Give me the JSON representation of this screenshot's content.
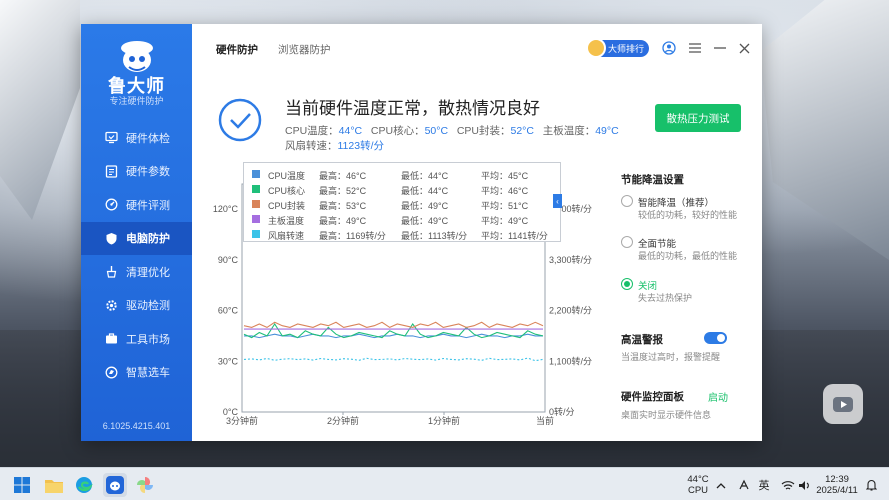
{
  "app": {
    "brand_name": "鲁大师",
    "brand_sub": "专注硬件防护",
    "version": "6.1025.4215.401",
    "nav": [
      {
        "label": "硬件体检",
        "icon": "monitor-check-icon"
      },
      {
        "label": "硬件参数",
        "icon": "list-icon"
      },
      {
        "label": "硬件评测",
        "icon": "speedometer-icon"
      },
      {
        "label": "电脑防护",
        "icon": "shield-icon",
        "active": true
      },
      {
        "label": "清理优化",
        "icon": "broom-icon"
      },
      {
        "label": "驱动检测",
        "icon": "gear-icon"
      },
      {
        "label": "工具市场",
        "icon": "briefcase-icon"
      },
      {
        "label": "智慧选车",
        "icon": "car-icon"
      }
    ],
    "tabs": [
      {
        "label": "硬件防护",
        "active": true
      },
      {
        "label": "浏览器防护",
        "active": false
      }
    ],
    "rank_button": "大师排行",
    "status": {
      "title": "当前硬件温度正常，散热情况良好",
      "line1": [
        {
          "label": "CPU温度：",
          "value": "44°C"
        },
        {
          "label": "CPU核心：",
          "value": "50°C"
        },
        {
          "label": "CPU封装：",
          "value": "52°C"
        },
        {
          "label": "主板温度：",
          "value": "49°C"
        }
      ],
      "line2": [
        {
          "label": "风扇转速：",
          "value": "1123转/分"
        }
      ]
    },
    "stress_button": "散热压力测试",
    "legend": [
      {
        "name": "CPU温度",
        "max": "最高：46°C",
        "min": "最低：44°C",
        "avg": "平均：45°C",
        "color": "#4a90d9"
      },
      {
        "name": "CPU核心",
        "max": "最高：52°C",
        "min": "最低：44°C",
        "avg": "平均：46°C",
        "color": "#1fbf7a"
      },
      {
        "name": "CPU封装",
        "max": "最高：53°C",
        "min": "最低：49°C",
        "avg": "平均：51°C",
        "color": "#d9845a"
      },
      {
        "name": "主板温度",
        "max": "最高：49°C",
        "min": "最低：49°C",
        "avg": "平均：49°C",
        "color": "#a56ee0"
      },
      {
        "name": "风扇转速",
        "max": "最高：1169转/分",
        "min": "最低：1113转/分",
        "avg": "平均：1141转/分",
        "color": "#3cc3e8"
      }
    ],
    "right_panel": {
      "title": "节能降温设置",
      "options": [
        {
          "label": "智能降温（推荐）",
          "desc": "较低的功耗，较好的性能",
          "checked": false
        },
        {
          "label": "全面节能",
          "desc": "最低的功耗，最低的性能",
          "checked": false
        },
        {
          "label": "关闭",
          "desc": "失去过热保护",
          "checked": true
        }
      ],
      "alarm_title": "高温警报",
      "alarm_desc": "当温度过高时，报警提醒",
      "alarm_on": true,
      "monitor_title": "硬件监控面板",
      "monitor_link": "启动",
      "monitor_desc": "桌面实时显示硬件信息"
    }
  },
  "chart_data": {
    "type": "line",
    "x_ticks": [
      "3分钟前",
      "2分钟前",
      "1分钟前",
      "当前"
    ],
    "y_left_ticks": [
      "0°C",
      "30°C",
      "60°C",
      "90°C",
      "120°C"
    ],
    "y_left_range": [
      0,
      150
    ],
    "y_right_ticks": [
      "0转/分",
      "1,100转/分",
      "2,200转/分",
      "3,300转/分",
      "4,400转/分"
    ],
    "y_right_range": [
      0,
      5500
    ],
    "series": [
      {
        "name": "CPU温度",
        "axis": "left",
        "color": "#4a90d9",
        "values": [
          45,
          45,
          44,
          45,
          46,
          45,
          45,
          44,
          45,
          46,
          45,
          45,
          44,
          45,
          45,
          46,
          45,
          44,
          45,
          45,
          46,
          45,
          45,
          44,
          45,
          45,
          46,
          45,
          45,
          44,
          45,
          46,
          45,
          45,
          44,
          45,
          45,
          46,
          45,
          45
        ]
      },
      {
        "name": "CPU核心",
        "axis": "left",
        "color": "#1fbf7a",
        "values": [
          46,
          44,
          47,
          45,
          52,
          45,
          46,
          44,
          48,
          46,
          45,
          50,
          46,
          44,
          45,
          47,
          46,
          45,
          44,
          48,
          46,
          45,
          52,
          46,
          44,
          45,
          47,
          46,
          45,
          50,
          46,
          44,
          45,
          47,
          46,
          45,
          44,
          48,
          46,
          45
        ]
      },
      {
        "name": "CPU封装",
        "axis": "left",
        "color": "#d9845a",
        "values": [
          51,
          50,
          52,
          50,
          53,
          51,
          50,
          52,
          51,
          50,
          52,
          51,
          53,
          50,
          51,
          52,
          50,
          51,
          53,
          50,
          52,
          51,
          50,
          52,
          51,
          53,
          50,
          51,
          52,
          50,
          51,
          53,
          50,
          52,
          51,
          50,
          52,
          51,
          53,
          51
        ]
      },
      {
        "name": "主板温度",
        "axis": "left",
        "color": "#a56ee0",
        "values": [
          49,
          49,
          49,
          49,
          49,
          49,
          49,
          49,
          49,
          49,
          49,
          49,
          49,
          49,
          49,
          49,
          49,
          49,
          49,
          49,
          49,
          49,
          49,
          49,
          49,
          49,
          49,
          49,
          49,
          49,
          49,
          49,
          49,
          49,
          49,
          49,
          49,
          49,
          49,
          49
        ]
      },
      {
        "name": "风扇转速",
        "axis": "right",
        "color": "#3cc3e8",
        "values": [
          1141,
          1150,
          1130,
          1160,
          1120,
          1145,
          1155,
          1135,
          1150,
          1125,
          1160,
          1140,
          1130,
          1155,
          1145,
          1120,
          1165,
          1135,
          1140,
          1150,
          1130,
          1160,
          1145,
          1135,
          1150,
          1125,
          1160,
          1140,
          1130,
          1155,
          1145,
          1120,
          1165,
          1135,
          1140,
          1150,
          1130,
          1169,
          1113,
          1140
        ]
      }
    ]
  },
  "taskbar": {
    "temp": "44°C",
    "temp_label": "CPU",
    "ime": "英",
    "time": "12:39",
    "date": "2025/4/11"
  }
}
